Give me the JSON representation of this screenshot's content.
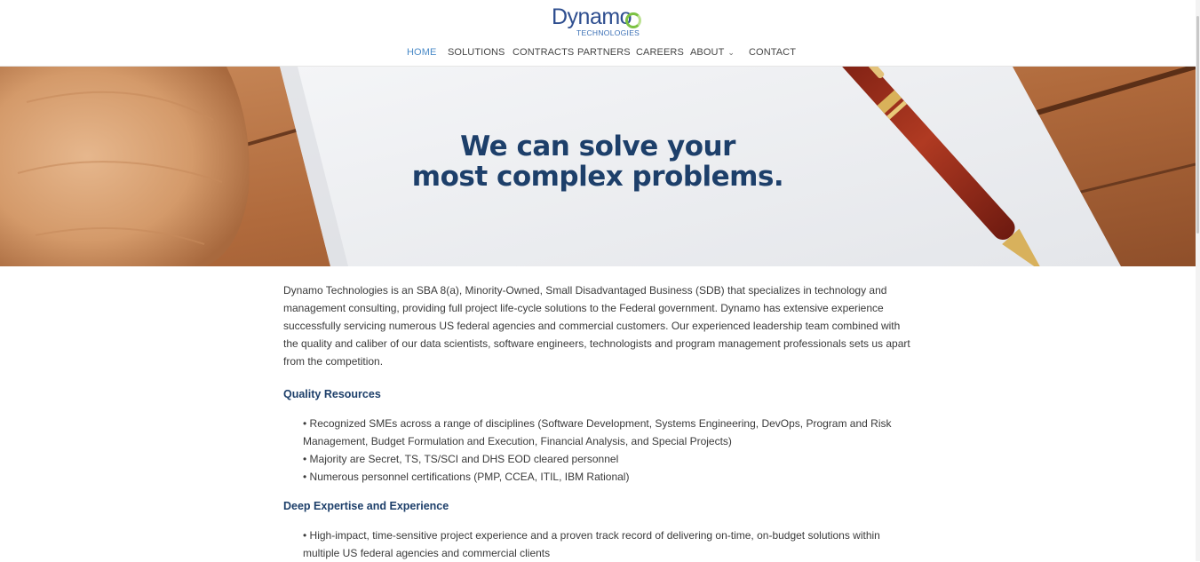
{
  "logo": {
    "word": "Dynamo",
    "subtitle": "TECHNOLOGIES"
  },
  "nav": {
    "items": [
      {
        "label": "HOME",
        "active": true
      },
      {
        "label": "SOLUTIONS"
      },
      {
        "label": "CONTRACTS"
      },
      {
        "label": "PARTNERS"
      },
      {
        "label": "CAREERS"
      },
      {
        "label": "ABOUT",
        "has_dropdown": true
      },
      {
        "label": "CONTACT"
      }
    ]
  },
  "hero": {
    "line1": "We can solve your",
    "line2": "most complex problems."
  },
  "content": {
    "intro": "Dynamo Technologies is an SBA 8(a), Minority-Owned, Small Disadvantaged Business (SDB) that specializes in technology and management consulting, providing full project life-cycle solutions to the Federal government. Dynamo has extensive experience successfully servicing numerous US federal agencies and commercial customers. Our experienced leadership team combined with the quality and caliber of our data scientists, software engineers, technologists and program management professionals sets us apart from the competition.",
    "sections": [
      {
        "heading": "Quality Resources",
        "bullets": [
          "• Recognized SMEs across a range of disciplines (Software Development, Systems Engineering, DevOps, Program and Risk Management, Budget Formulation and Execution, Financial Analysis, and Special Projects)",
          "• Majority are Secret, TS, TS/SCI and DHS EOD cleared personnel",
          "• Numerous personnel certifications (PMP, CCEA, ITIL, IBM Rational)"
        ]
      },
      {
        "heading": "Deep Expertise and Experience",
        "bullets": [
          "• High-impact, time-sensitive project experience and a proven track record of delivering on-time, on-budget solutions within multiple US federal agencies and commercial clients"
        ]
      }
    ]
  },
  "colors": {
    "heading_navy": "#1d3f6a",
    "nav_active": "#4a8ac7",
    "logo_blue": "#2e4e8f",
    "logo_green": "#7cc243"
  }
}
